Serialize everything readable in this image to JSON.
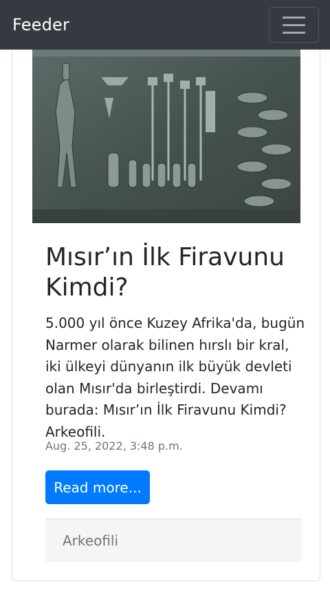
{
  "navbar": {
    "brand": "Feeder",
    "toggler_icon": "hamburger-menu-icon"
  },
  "post": {
    "image_description_icon": "egyptian-relief-image",
    "title": "Mısır’ın İlk Firavunu Kimdi?",
    "text": "5.000 yıl önce Kuzey Afrika'da, bugün Narmer olarak bilinen hırslı bir kral, iki ülkeyi dünyanın ilk büyük devleti olan Mısır'da birleştirdi. Devamı burada: Mısır’ın İlk Firavunu Kimdi? Arkeofili.",
    "date": "Aug. 25, 2022, 3:48 p.m.",
    "read_more_label": "Read more...",
    "source": "Arkeofili"
  },
  "colors": {
    "navbar_bg": "#343a40",
    "button_bg": "#007bff",
    "footer_bg": "#f5f5f5",
    "muted_text": "#6c757d"
  }
}
